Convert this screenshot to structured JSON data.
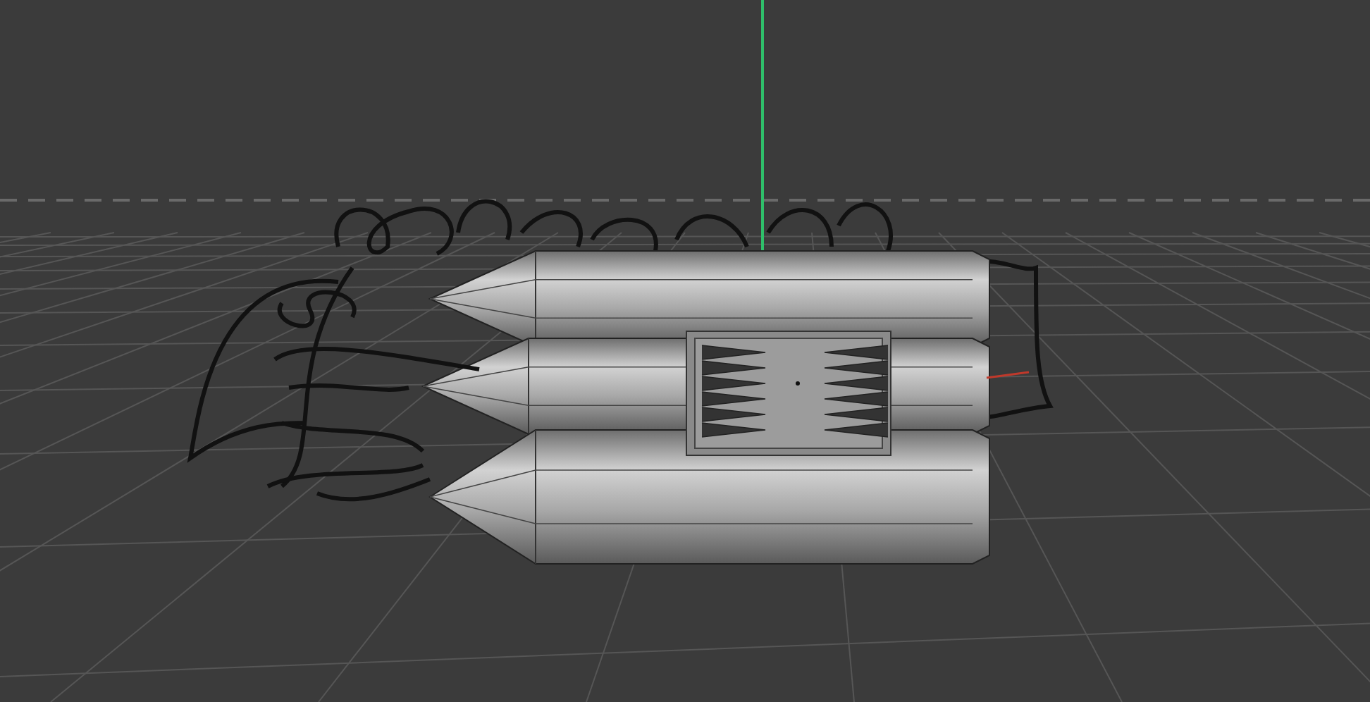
{
  "viewport": {
    "grid_visible": true,
    "horizon_visible": true,
    "y_axis_visible": true,
    "x_axis_visible": true
  }
}
